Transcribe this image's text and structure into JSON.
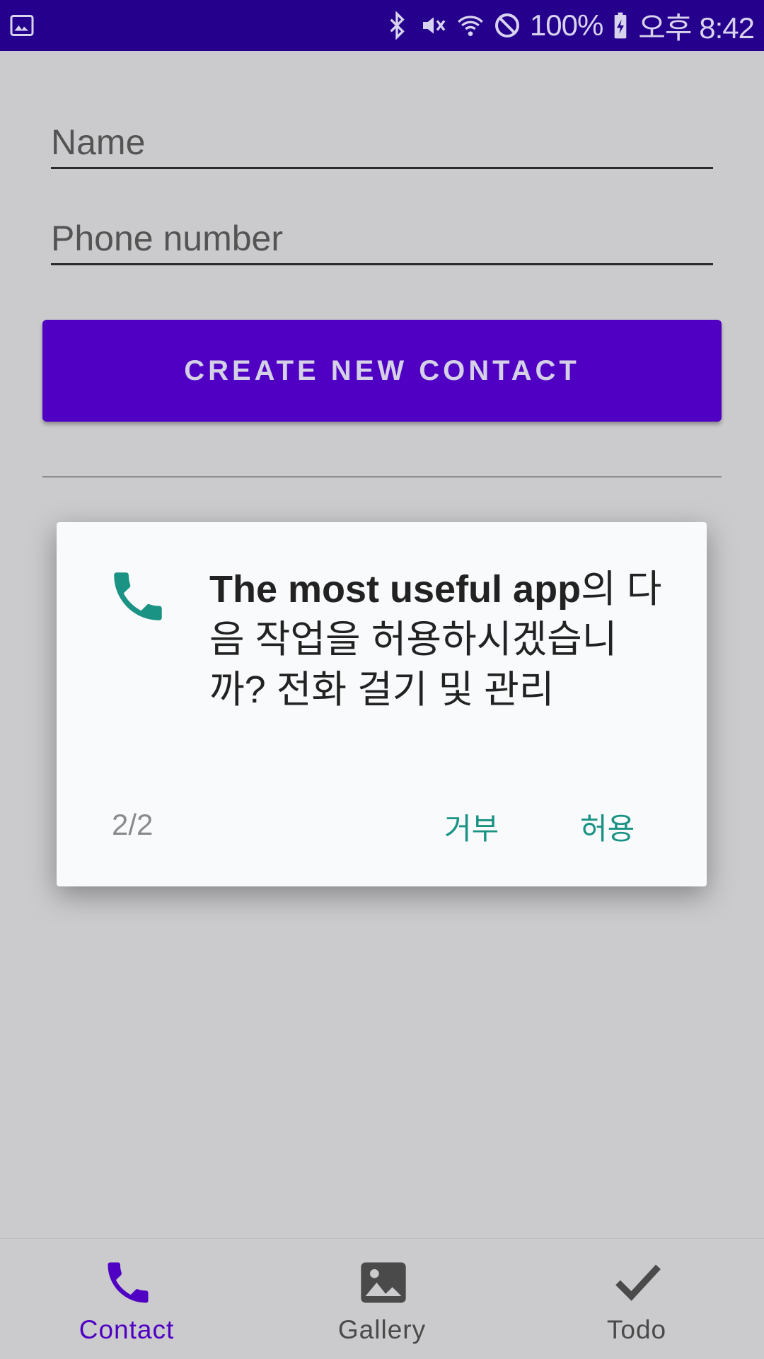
{
  "status_bar": {
    "battery": "100%",
    "time": "오후 8:42",
    "left_icon": "image-icon",
    "right_icons": [
      "bluetooth-icon",
      "vibrate-mute-icon",
      "wifi-icon",
      "do-not-disturb-icon",
      "battery-charging-icon"
    ]
  },
  "form": {
    "name_placeholder": "Name",
    "phone_placeholder": "Phone number",
    "create_button": "CREATE NEW CONTACT"
  },
  "dialog": {
    "icon": "phone-icon",
    "app_name": "The most useful app",
    "message_rest": "의 다음 작업을 허용하시겠습니까? 전화 걸기 및 관리",
    "counter": "2/2",
    "deny_label": "거부",
    "allow_label": "허용"
  },
  "bottom_nav": {
    "items": [
      {
        "label": "Contact",
        "icon": "phone-icon",
        "active": true
      },
      {
        "label": "Gallery",
        "icon": "image-icon",
        "active": false
      },
      {
        "label": "Todo",
        "icon": "check-icon",
        "active": false
      }
    ]
  },
  "colors": {
    "status_bar": "#24008c",
    "primary": "#4f00c3",
    "accent": "#1a9385",
    "background_dim": "#cbcbcd",
    "nav_active": "#4f00c3",
    "nav_inactive": "#4a4a4a"
  }
}
